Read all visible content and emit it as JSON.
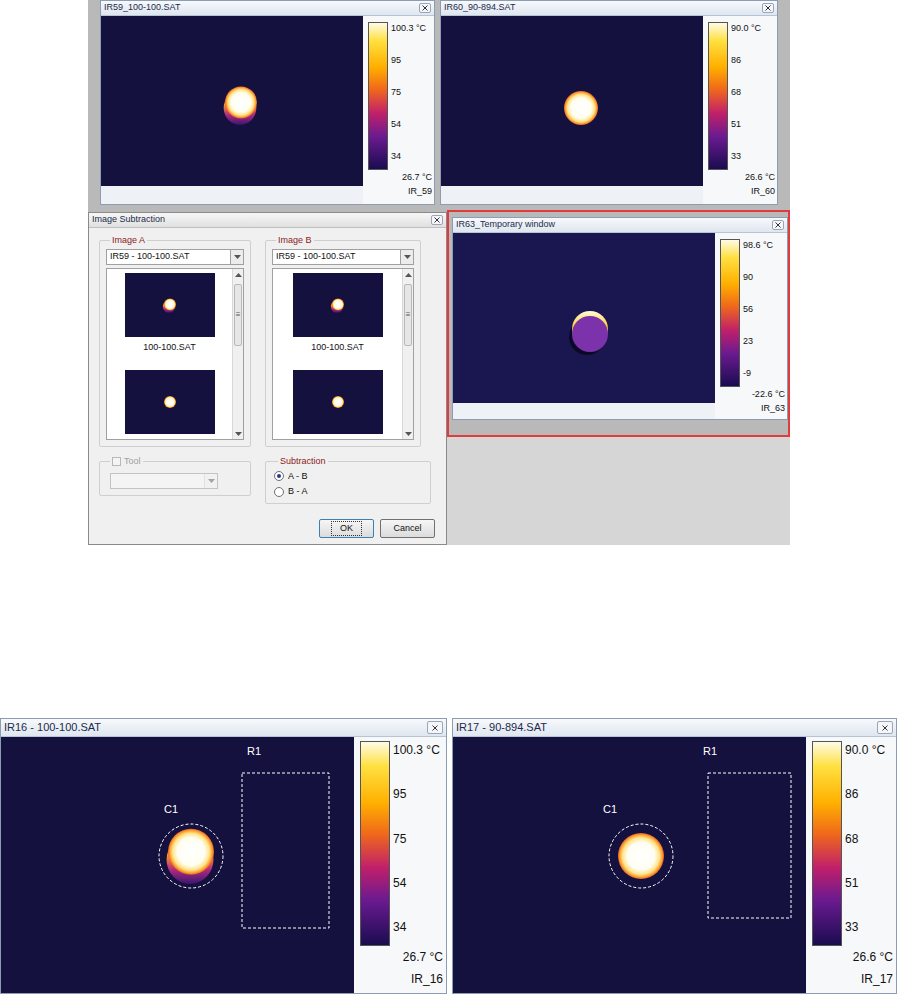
{
  "source_windows": [
    {
      "title": "IR59_100-100.SAT",
      "kind": "blur",
      "scale": {
        "max": "100.3 °C",
        "ticks": [
          "95",
          "75",
          "54",
          "34"
        ],
        "min": "26.7 °C"
      },
      "id": "IR_59"
    },
    {
      "title": "IR60_90-894.SAT",
      "kind": "sharp",
      "scale": {
        "max": "90.0 °C",
        "ticks": [
          "86",
          "68",
          "51",
          "33"
        ],
        "min": "26.6 °C"
      },
      "id": "IR_60"
    }
  ],
  "dialog": {
    "title": "Image Subtraction",
    "groups": [
      {
        "label": "Image A",
        "dropdown": "IR59 - 100-100.SAT",
        "thumbnails": [
          {
            "label": "100-100.SAT",
            "kind": "blur"
          },
          {
            "label": null,
            "kind": "sharp"
          }
        ]
      },
      {
        "label": "Image B",
        "dropdown": "IR59 - 100-100.SAT",
        "thumbnails": [
          {
            "label": "100-100.SAT",
            "kind": "blur"
          },
          {
            "label": null,
            "kind": "sharp"
          }
        ]
      }
    ],
    "scroll_grip": "≡",
    "tool": {
      "label": "Tool",
      "checked": false,
      "disabled": true
    },
    "subtraction": {
      "label": "Subtraction",
      "options": [
        {
          "label": "A - B",
          "selected": true
        },
        {
          "label": "B - A",
          "selected": false
        }
      ]
    },
    "buttons": [
      {
        "label": "OK",
        "focused": true
      },
      {
        "label": "Cancel",
        "focused": false
      }
    ]
  },
  "result_window": {
    "title": "IR63_Temporary window",
    "kind": "difference",
    "highlighted": true,
    "scale": {
      "max": "98.6 °C",
      "ticks": [
        "90",
        "56",
        "23",
        "-9"
      ],
      "min": "-22.6 °C"
    },
    "id": "IR_63"
  },
  "analysis_windows": [
    {
      "title": "IR16 - 100-100.SAT",
      "kind": "blur",
      "scale": {
        "max": "100.3 °C",
        "ticks": [
          "95",
          "75",
          "54",
          "34"
        ],
        "min": "26.7 °C"
      },
      "id": "IR_16",
      "markers": [
        {
          "label": "C1",
          "kind": "circle"
        },
        {
          "label": "R1",
          "kind": "rect"
        }
      ]
    },
    {
      "title": "IR17 - 90-894.SAT",
      "kind": "sharp",
      "scale": {
        "max": "90.0 °C",
        "ticks": [
          "86",
          "68",
          "51",
          "33"
        ],
        "min": "26.6 °C"
      },
      "id": "IR_17",
      "markers": [
        {
          "label": "C1",
          "kind": "circle"
        },
        {
          "label": "R1",
          "kind": "rect"
        }
      ]
    }
  ]
}
